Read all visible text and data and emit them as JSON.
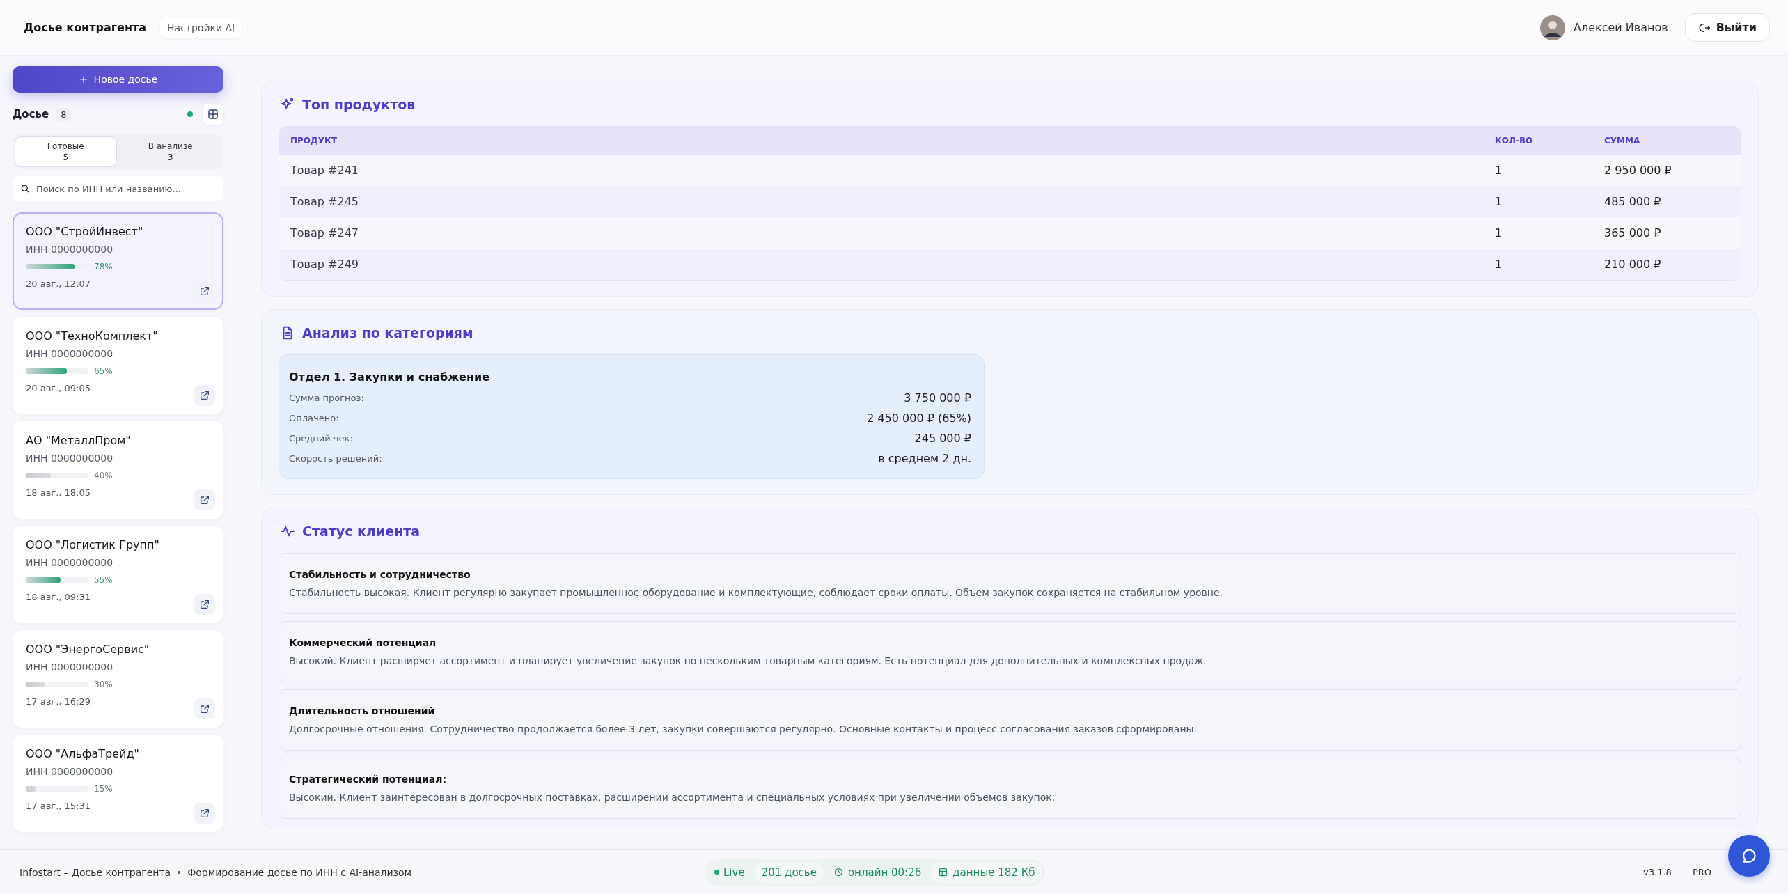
{
  "header": {
    "tabs": [
      {
        "label": "Досье контрагента",
        "selected": true
      },
      {
        "label": "Настройки AI",
        "selected": false
      }
    ],
    "user_name": "Алексей Иванов",
    "logout": "Выйти"
  },
  "sidebar": {
    "new_button": "Новое досье",
    "list_title": "Досье",
    "count": "8",
    "tabs": [
      {
        "label": "Готовые",
        "count": "5",
        "selected": true
      },
      {
        "label": "В анализе",
        "count": "3",
        "selected": false
      }
    ],
    "search": {
      "placeholder": "Поиск по ИНН или названию..."
    },
    "dossiers": [
      {
        "name": "ООО \"СтройИнвест\"",
        "inn": "ИНН 0000000000",
        "level": 0.78,
        "percent": "78%",
        "date": "20 авг., 12:07",
        "selected": true
      },
      {
        "name": "ООО \"ТехноКомплект\"",
        "inn": "ИНН 0000000000",
        "level": 0.65,
        "percent": "65%",
        "date": "20 авг., 09:05",
        "selected": false
      },
      {
        "name": "АО \"МеталлПром\"",
        "inn": "ИНН 0000000000",
        "level": 0.4,
        "percent": "40%",
        "date": "18 авг., 18:05",
        "selected": false
      },
      {
        "name": "ООО \"Логистик Групп\"",
        "inn": "ИНН 0000000000",
        "level": 0.55,
        "percent": "55%",
        "date": "18 авг., 09:31",
        "selected": false
      },
      {
        "name": "ООО \"ЭнергоСервис\"",
        "inn": "ИНН 0000000000",
        "level": 0.3,
        "percent": "30%",
        "date": "17 авг., 16:29",
        "selected": false
      },
      {
        "name": "ООО \"АльфаТрейд\"",
        "inn": "ИНН 0000000000",
        "level": 0.15,
        "percent": "15%",
        "date": "17 авг., 15:31",
        "selected": false
      }
    ]
  },
  "top_products": {
    "title": "Топ продуктов",
    "columns": [
      "ПРОДУКТ",
      "КОЛ-ВО",
      "СУММА"
    ],
    "rows": [
      [
        "Товар #241",
        "1",
        "2 950 000 ₽"
      ],
      [
        "Товар #245",
        "1",
        "485 000 ₽"
      ],
      [
        "Товар #247",
        "1",
        "365 000 ₽"
      ],
      [
        "Товар #249",
        "1",
        "210 000 ₽"
      ]
    ]
  },
  "categories": {
    "title": "Анализ по категориям",
    "department": {
      "title": "Отдел 1. Закупки и снабжение",
      "rows": [
        {
          "label": "Сумма прогноз:",
          "value": "3 750 000 ₽"
        },
        {
          "label": "Оплачено:",
          "value": "2 450 000 ₽ (65%)"
        },
        {
          "label": "Средний чек:",
          "value": "245 000 ₽"
        },
        {
          "label": "Скорость решений:",
          "value": "в среднем 2 дн."
        }
      ]
    }
  },
  "client_status": {
    "title": "Статус клиента",
    "items": [
      {
        "title": "Стабильность и сотрудничество",
        "text": "Стабильность высокая. Клиент регулярно закупает промышленное оборудование и комплектующие, соблюдает сроки оплаты. Объем закупок сохраняется на стабильном уровне."
      },
      {
        "title": "Коммерческий потенциал",
        "text": "Высокий. Клиент расширяет ассортимент и планирует увеличение закупок по нескольким товарным категориям. Есть потенциал для дополнительных и комплексных продаж."
      },
      {
        "title": "Длительность отношений",
        "text": "Долгосрочные отношения. Сотрудничество продолжается более 3 лет, закупки совершаются регулярно. Основные контакты и процесс согласования заказов сформированы."
      },
      {
        "title": "Стратегический потенциал:",
        "text": "Высокий. Клиент заинтересован в долгосрочных поставках, расширении ассортимента и специальных условиях при увеличении объемов закупок."
      }
    ]
  },
  "footer": {
    "app": "Infostart – Досье контрагента",
    "subtitle": "Формирование досье по ИНН с AI-анализом",
    "stats": [
      {
        "kind": "live",
        "label": "Live"
      },
      {
        "kind": "count",
        "label": "201 досье"
      },
      {
        "kind": "online",
        "label": "онлайн 00:26"
      },
      {
        "kind": "data",
        "label": "данные 182 Кб"
      }
    ],
    "version": "v3.1.8",
    "plan": "PRO"
  }
}
